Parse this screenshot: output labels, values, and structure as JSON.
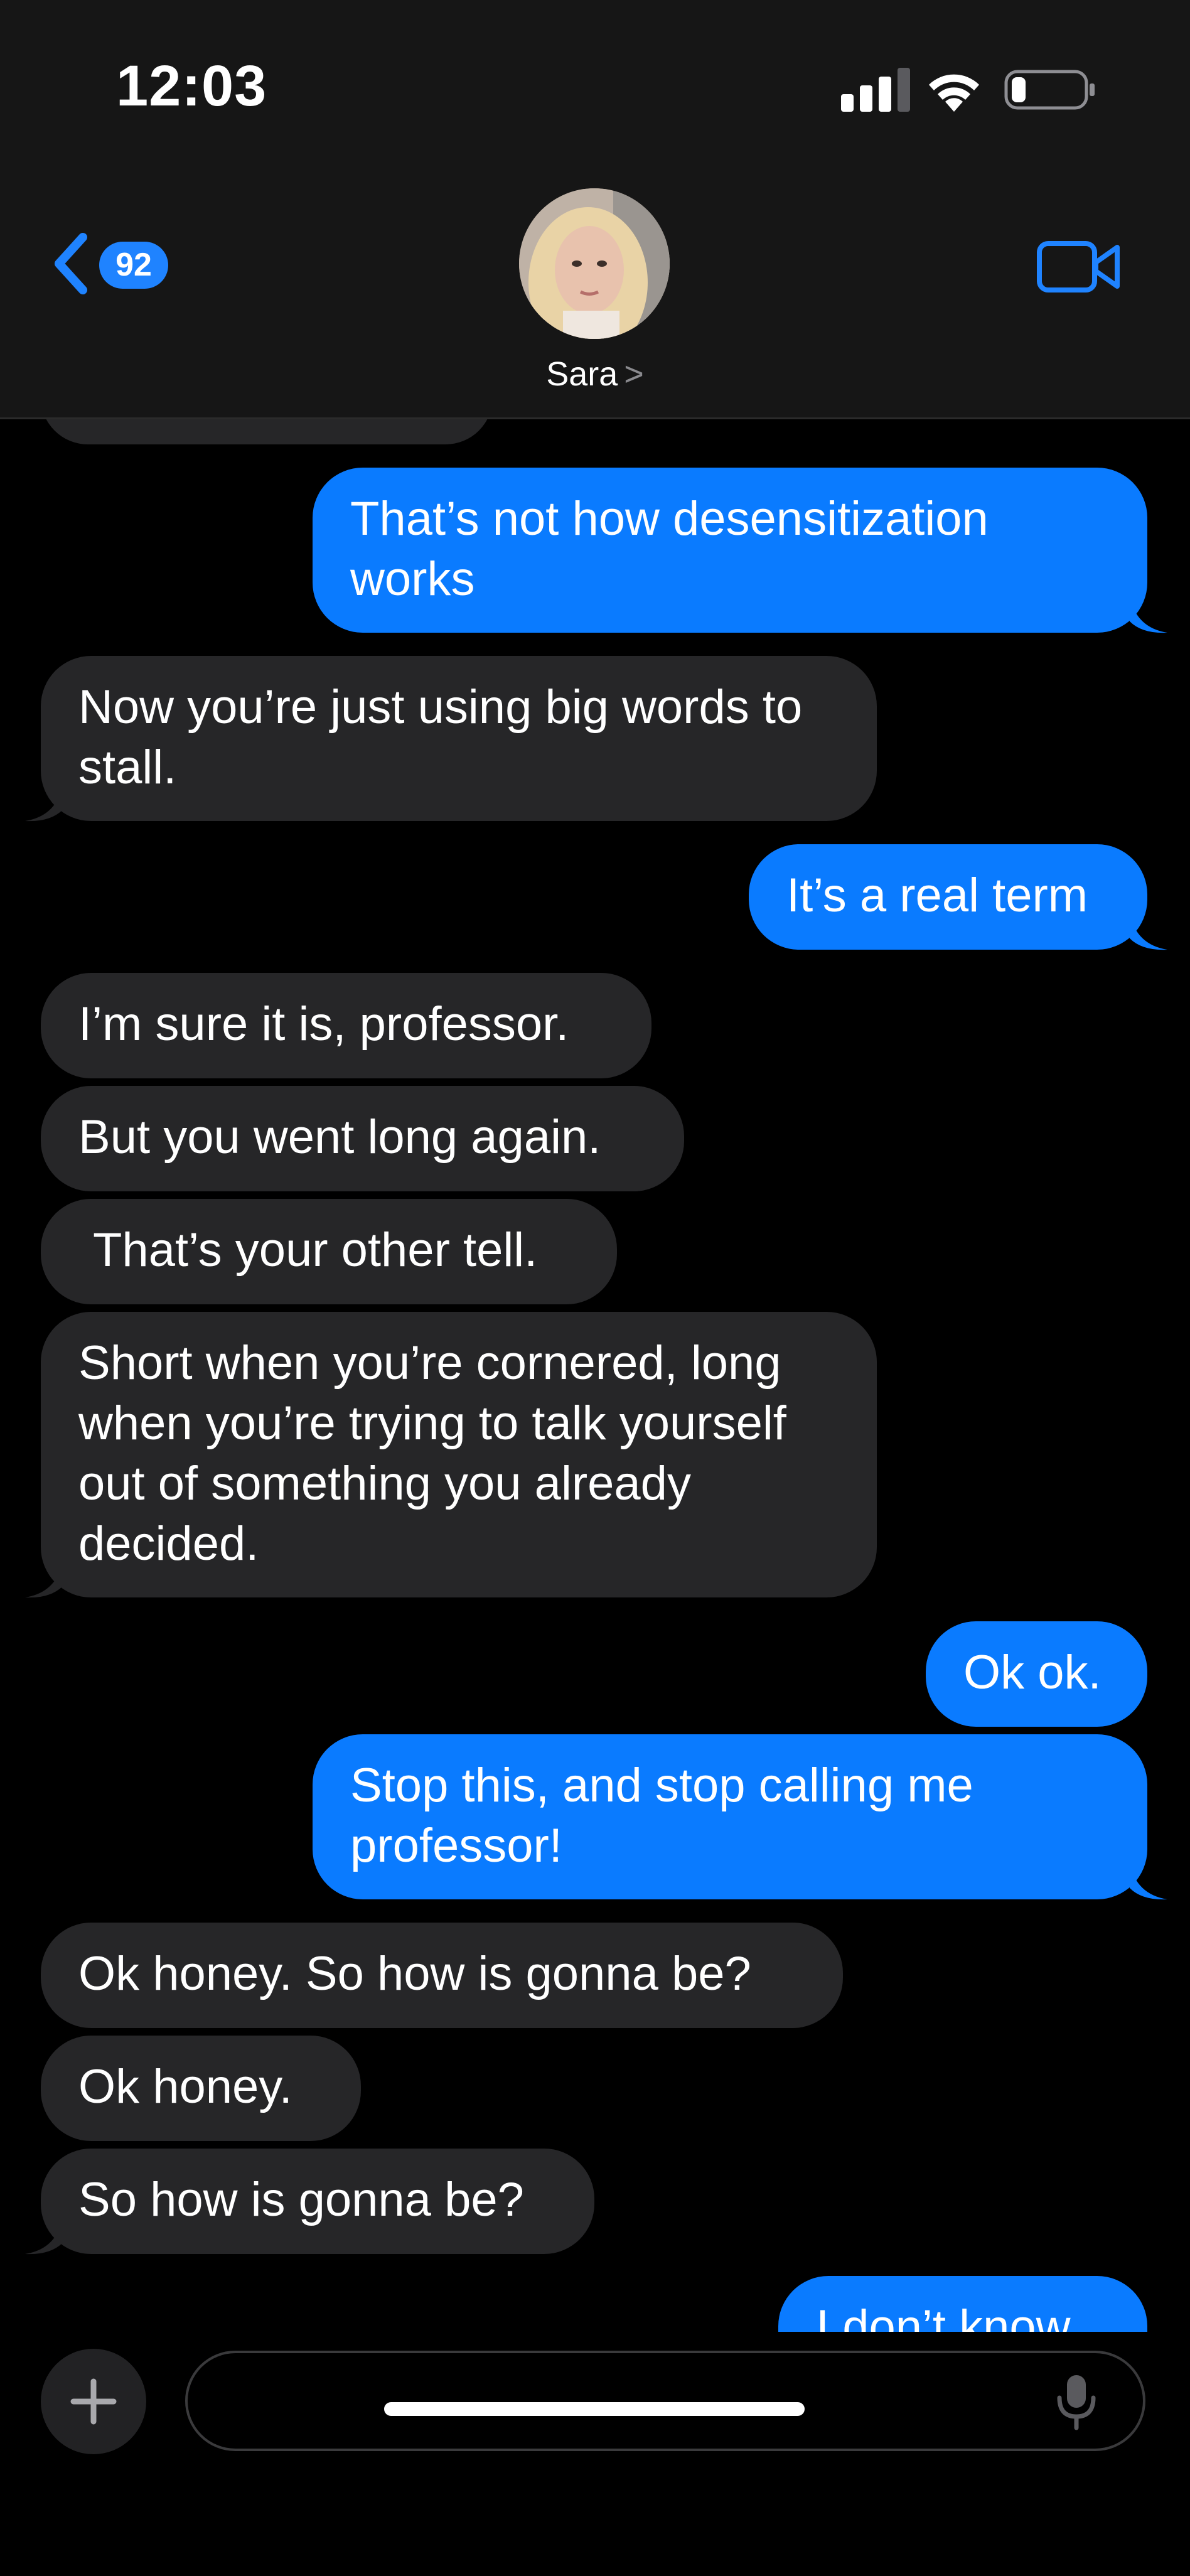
{
  "status_bar": {
    "time": "12:03"
  },
  "header": {
    "back_badge_count": "92",
    "contact_name": "Sara",
    "contact_chevron": ">"
  },
  "messages": [
    {
      "side": "sent",
      "text": "That’s not how desensitization works"
    },
    {
      "side": "received",
      "text": "Now you’re just using big words to stall."
    },
    {
      "side": "sent",
      "text": "It’s a real term"
    },
    {
      "side": "received",
      "text": "I’m sure it is, professor."
    },
    {
      "side": "received",
      "text": "But you went long again."
    },
    {
      "side": "received",
      "text": "That’s your other tell."
    },
    {
      "side": "received",
      "text": "Short when you’re cornered, long when you’re trying to talk yourself out of something you already decided."
    },
    {
      "side": "sent",
      "text": "Ok ok."
    },
    {
      "side": "sent",
      "text": "Stop this, and stop calling me professor!"
    },
    {
      "side": "received",
      "text": "Ok honey. So how is gonna be?"
    },
    {
      "side": "received",
      "text": "Ok honey."
    },
    {
      "side": "received",
      "text": "So how is gonna be?"
    },
    {
      "side": "sent",
      "text": "I don’t know"
    }
  ],
  "input": {
    "value": "",
    "placeholder": ""
  },
  "colors": {
    "sent_bubble": "#0a7bff",
    "received_bubble": "#262628",
    "accent": "#1f83ff"
  },
  "icons": {
    "back": "chevron-left-icon",
    "video": "video-camera-icon",
    "plus": "plus-icon",
    "mic": "microphone-icon"
  }
}
